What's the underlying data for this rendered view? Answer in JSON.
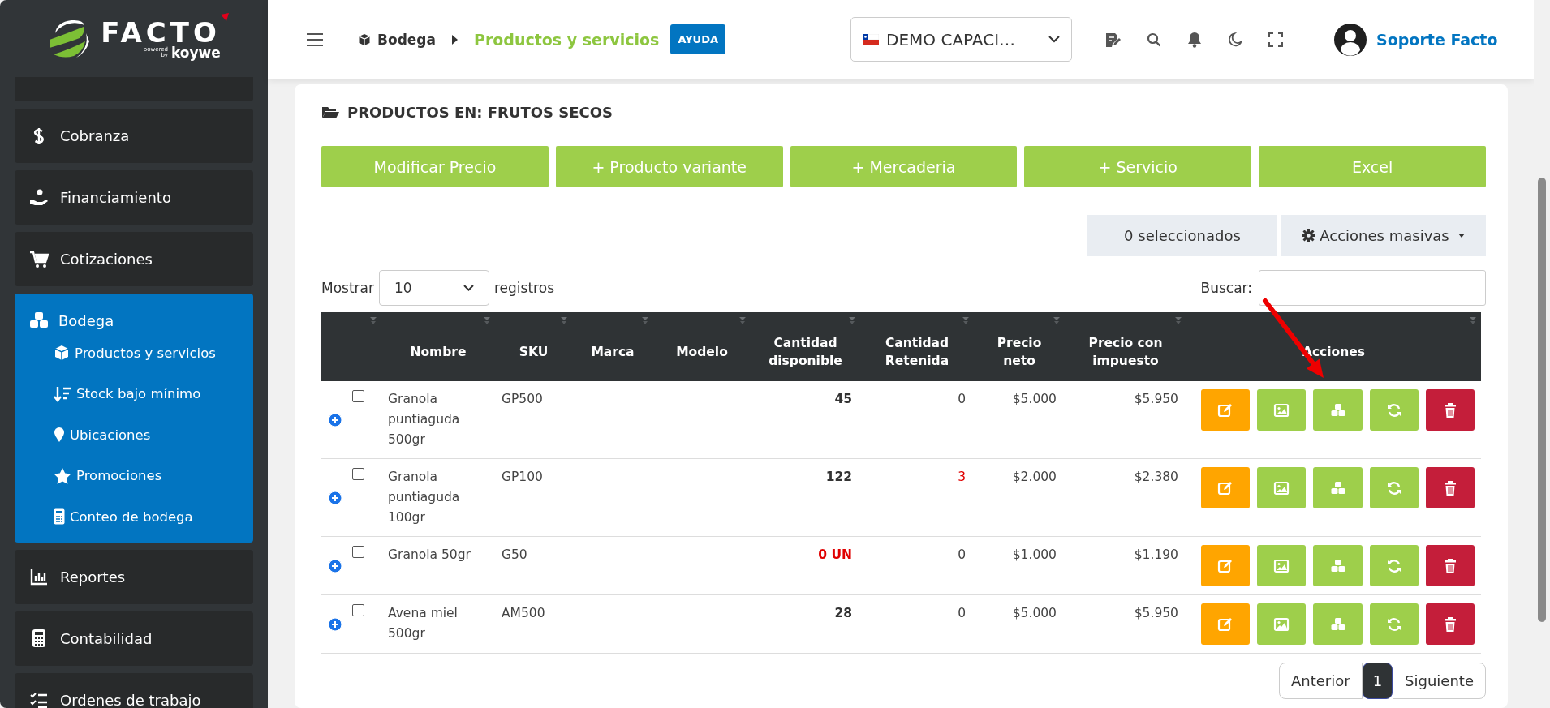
{
  "logo": {
    "wordmark": "FACTO",
    "powered": "powered",
    "by": "by",
    "brand": "koywe"
  },
  "sidebar": {
    "items": [
      {
        "label": "Cobranza",
        "selected": false
      },
      {
        "label": "Financiamiento",
        "selected": false
      },
      {
        "label": "Cotizaciones",
        "selected": false
      },
      {
        "label": "Bodega",
        "selected": true,
        "children": [
          {
            "label": "Productos y servicios"
          },
          {
            "label": "Stock bajo mínimo"
          },
          {
            "label": "Ubicaciones"
          },
          {
            "label": "Promociones"
          },
          {
            "label": "Conteo de bodega"
          }
        ]
      },
      {
        "label": "Reportes",
        "selected": false
      },
      {
        "label": "Contabilidad",
        "selected": false
      },
      {
        "label": "Ordenes de trabajo",
        "selected": false
      }
    ]
  },
  "topbar": {
    "breadcrumb": [
      "Bodega",
      "Productos y servicios"
    ],
    "help": "AYUDA",
    "company": "DEMO CAPACI…",
    "user": "Soporte Facto"
  },
  "title": "PRODUCTOS EN: FRUTOS SECOS",
  "actions": [
    "Modificar Precio",
    "+ Producto variante",
    "+ Mercaderia",
    "+ Servicio",
    "Excel"
  ],
  "selection_count": "0 seleccionados",
  "bulk_actions": "Acciones masivas",
  "length": {
    "before": "Mostrar",
    "value": "10",
    "after": "registros"
  },
  "search": {
    "label": "Buscar:"
  },
  "table": {
    "columns": [
      "",
      "Nombre",
      "SKU",
      "Marca",
      "Modelo",
      "Cantidad disponible",
      "Cantidad Retenida",
      "Precio neto",
      "Precio con impuesto",
      "Acciones"
    ],
    "rows": [
      {
        "checked": false,
        "name": "Granola puntiaguda 500gr",
        "sku": "GP500",
        "available": "45",
        "available_alert": false,
        "retained": "0",
        "retained_alert": false,
        "price": "$5.000",
        "price_tax": "$5.950"
      },
      {
        "checked": false,
        "name": "Granola puntiaguda 100gr",
        "sku": "GP100",
        "available": "122",
        "available_alert": false,
        "retained": "3",
        "retained_alert": true,
        "price": "$2.000",
        "price_tax": "$2.380"
      },
      {
        "checked": false,
        "name": "Granola 50gr",
        "sku": "G50",
        "available": "0 UN",
        "available_alert": true,
        "retained": "0",
        "retained_alert": false,
        "price": "$1.000",
        "price_tax": "$1.190"
      },
      {
        "checked": false,
        "name": "Avena miel 500gr",
        "sku": "AM500",
        "available": "28",
        "available_alert": false,
        "retained": "0",
        "retained_alert": false,
        "price": "$5.000",
        "price_tax": "$5.950"
      }
    ]
  },
  "pagination": {
    "previous": "Anterior",
    "pages": [
      {
        "label": "1",
        "selected": true
      }
    ],
    "next": "Siguiente"
  }
}
